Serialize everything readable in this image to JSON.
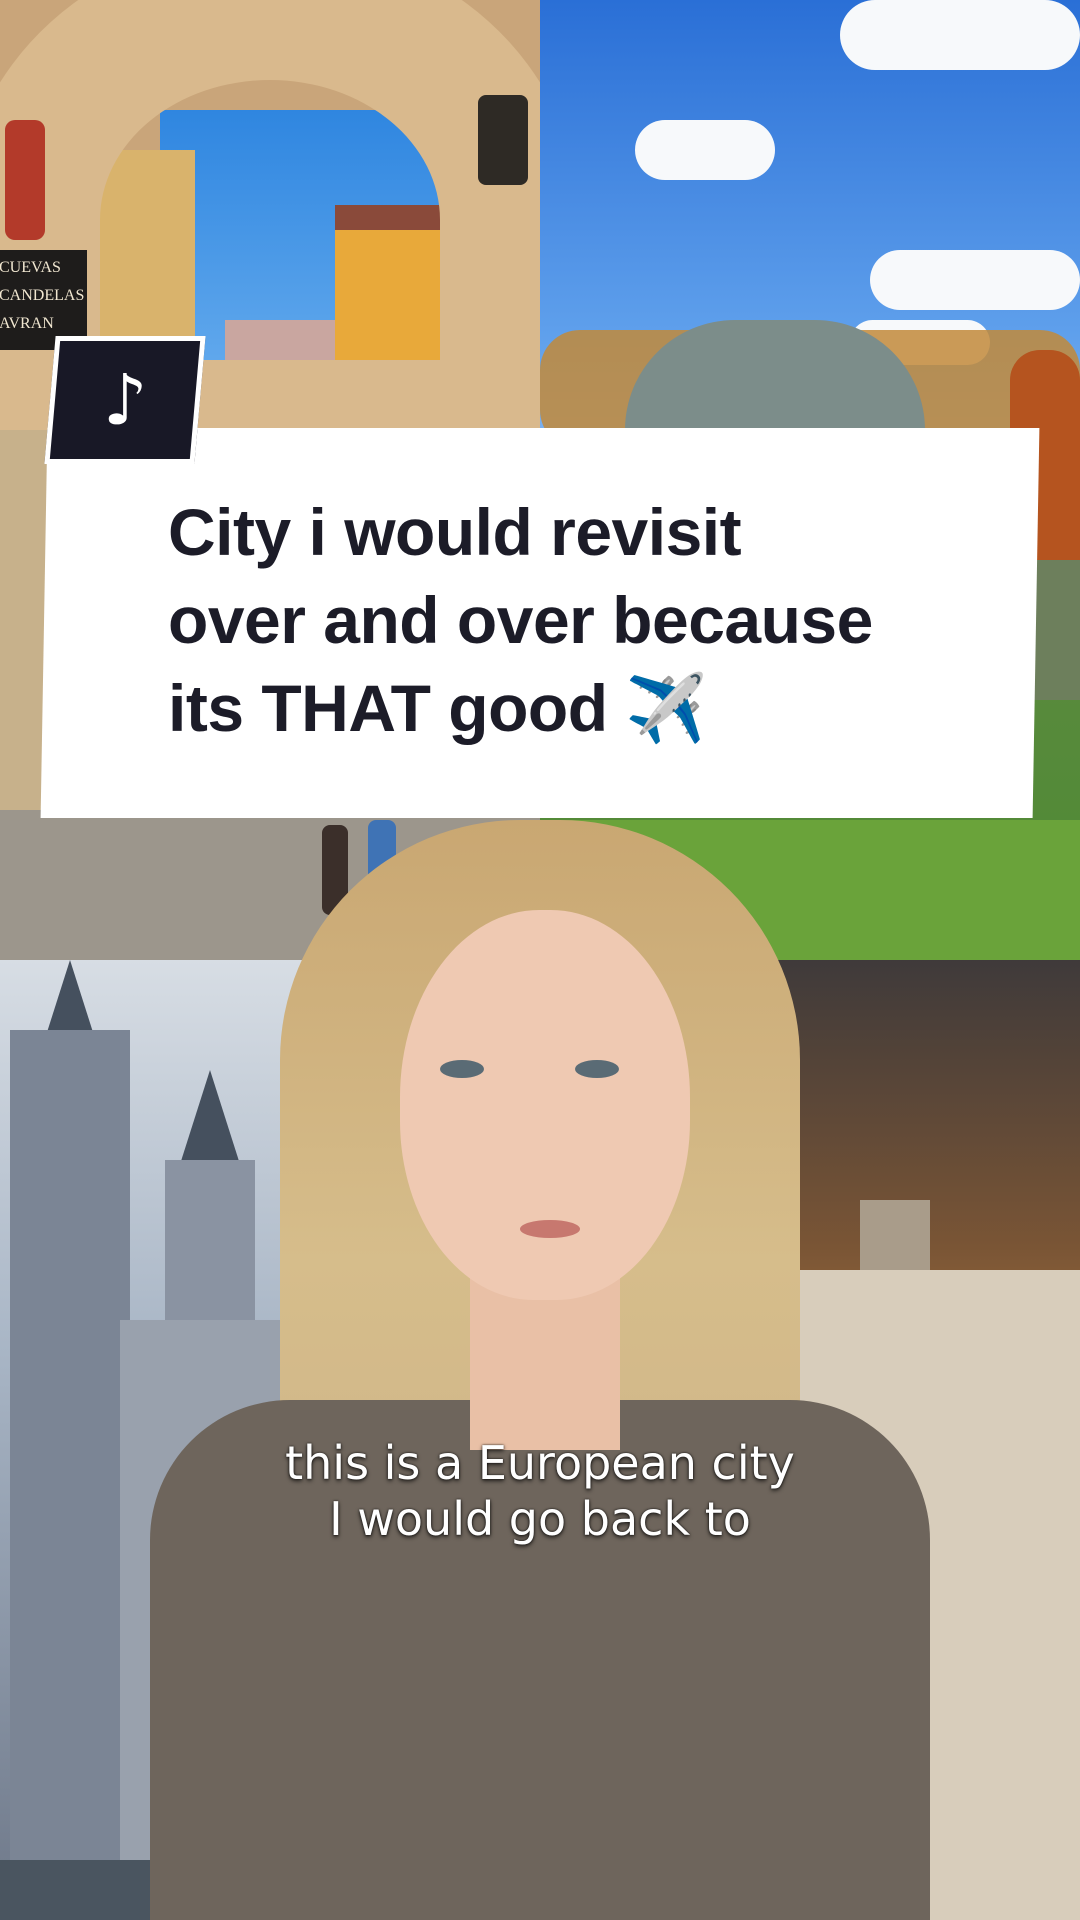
{
  "title_card": {
    "text": "City i would revisit\nover and over because\nits THAT good ✈️"
  },
  "caption": {
    "text": "this is a European city\nI would go back to"
  },
  "logo": {
    "icon": "tiktok-note-icon",
    "glyph": "♪"
  },
  "background": {
    "top_left_sign_lines": [
      "CUEVAS",
      "CANDELAS",
      "AVRAN"
    ]
  },
  "colors": {
    "card_bg": "#ffffff",
    "title_text": "#1c1c28",
    "logo_bg": "#181826",
    "caption_text": "#ffffff"
  }
}
